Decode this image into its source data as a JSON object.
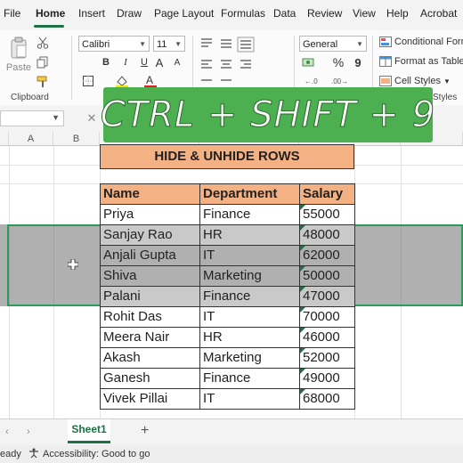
{
  "menu": {
    "tabs": [
      "File",
      "Home",
      "Insert",
      "Draw",
      "Page Layout",
      "Formulas",
      "Data",
      "Review",
      "View",
      "Help",
      "Acrobat"
    ],
    "active": "Home"
  },
  "ribbon": {
    "clipboard": {
      "paste_label": "Paste",
      "group_label": "Clipboard"
    },
    "font": {
      "name": "Calibri",
      "size": "11",
      "bold": "B",
      "italic": "I",
      "underline": "U",
      "grow": "A",
      "shrink": "A"
    },
    "number": {
      "format": "General",
      "percent": "%",
      "comma": "9"
    },
    "styles": {
      "conditional": "Conditional Formatting",
      "format_table": "Format as Table",
      "cell_styles": "Cell Styles",
      "group_label": "Styles"
    }
  },
  "overlay_title": "CTRL + SHIFT + 9",
  "sheet": {
    "columns": [
      "A",
      "B"
    ],
    "header_label": "HIDE & UNHIDE ROWS",
    "table_headers": [
      "Name",
      "Department",
      "Salary"
    ],
    "rows": [
      {
        "name": "Priya",
        "dept": "Finance",
        "salary": "55000"
      },
      {
        "name": "Sanjay Rao",
        "dept": "HR",
        "salary": "48000"
      },
      {
        "name": "Anjali Gupta",
        "dept": "IT",
        "salary": "62000"
      },
      {
        "name": "Shiva",
        "dept": "Marketing",
        "salary": "50000"
      },
      {
        "name": "Palani",
        "dept": "Finance",
        "salary": "47000"
      },
      {
        "name": "Rohit Das",
        "dept": "IT",
        "salary": "70000"
      },
      {
        "name": "Meera Nair",
        "dept": "HR",
        "salary": "46000"
      },
      {
        "name": "Akash",
        "dept": "Marketing",
        "salary": "52000"
      },
      {
        "name": "Ganesh",
        "dept": "Finance",
        "salary": "49000"
      },
      {
        "name": "Vivek Pillai",
        "dept": "IT",
        "salary": "68000"
      }
    ]
  },
  "sheet_tabs": {
    "active": "Sheet1",
    "add": "+"
  },
  "status": {
    "ready": "eady",
    "accessibility": "Accessibility: Good to go"
  },
  "colors": {
    "accent": "#1e7145",
    "banner": "#4caf50",
    "header_fill": "#f4b183",
    "selection_outline": "#2d9a5d"
  }
}
